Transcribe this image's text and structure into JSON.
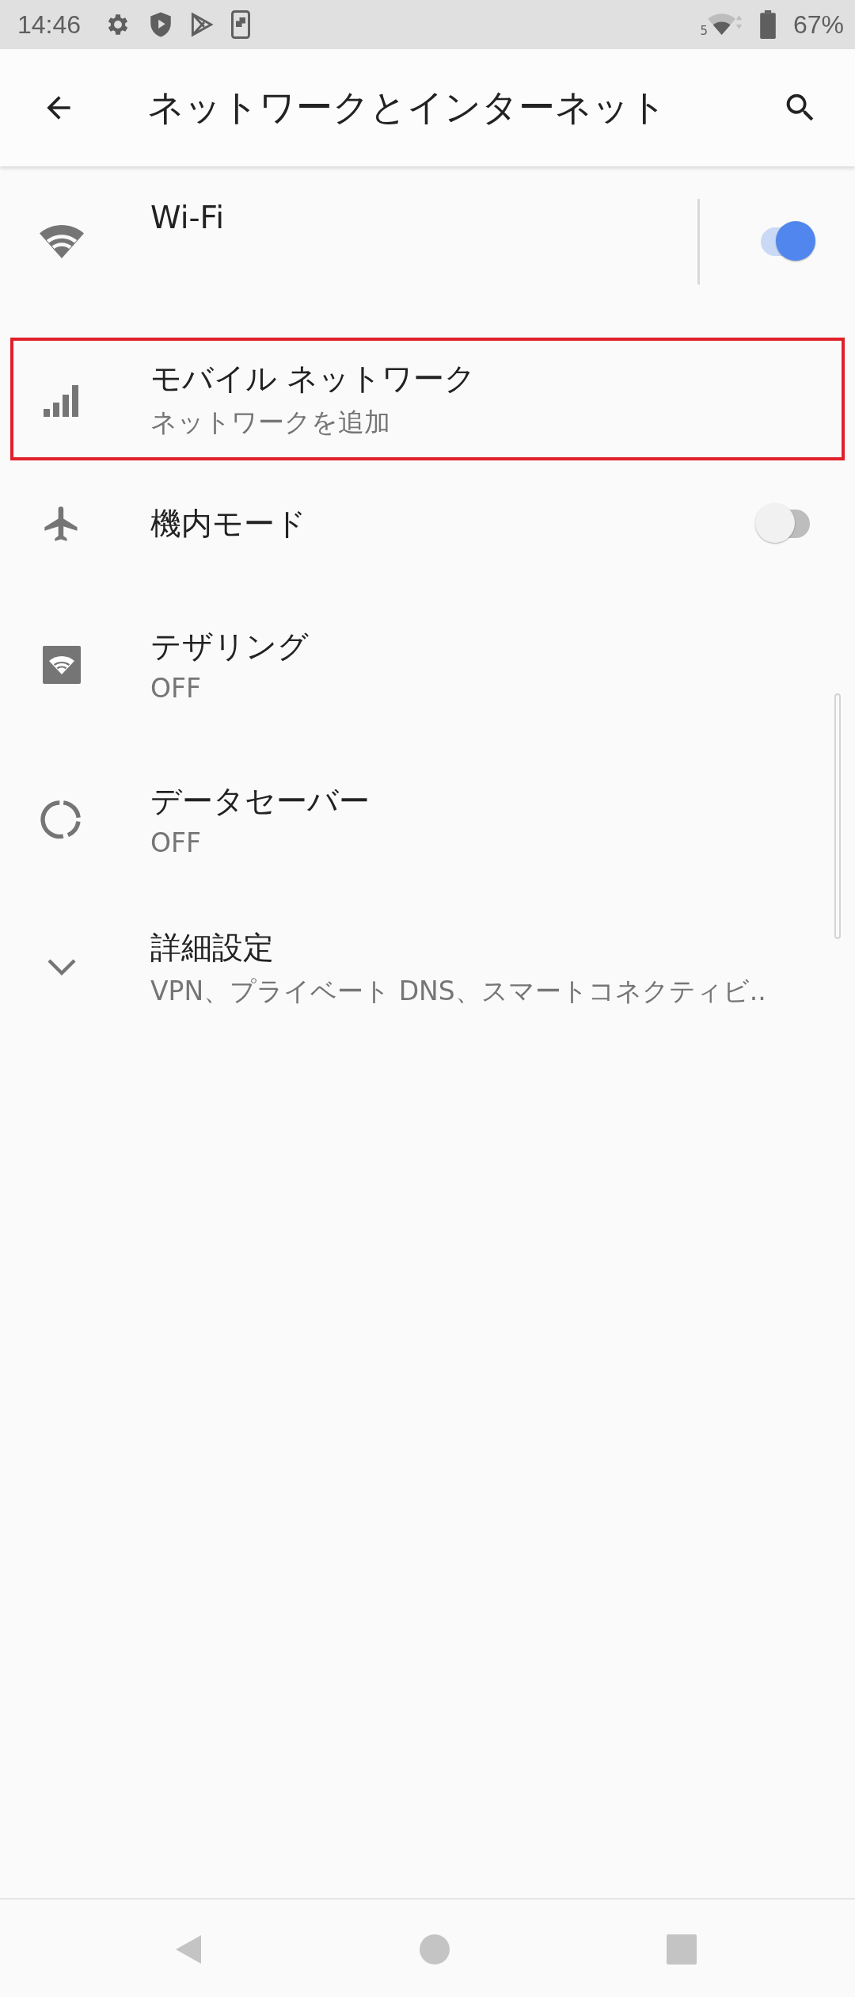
{
  "status_bar": {
    "time": "14:46",
    "wifi_label": "5",
    "battery": "67%"
  },
  "app_bar": {
    "title": "ネットワークとインターネット"
  },
  "items": [
    {
      "kind": "toggle",
      "title": "Wi-Fi",
      "on": true,
      "highlighted": false
    },
    {
      "kind": "plain",
      "title": "モバイル ネットワーク",
      "summary": "ネットワークを追加",
      "highlighted": true
    },
    {
      "kind": "toggle",
      "title": "機内モード",
      "on": false,
      "highlighted": false
    },
    {
      "kind": "plain",
      "title": "テザリング",
      "summary": "OFF",
      "highlighted": false
    },
    {
      "kind": "plain",
      "title": "データセーバー",
      "summary": "OFF",
      "highlighted": false
    },
    {
      "kind": "plain",
      "title": "詳細設定",
      "summary": "VPN、プライベート DNS、スマートコネクティビ..",
      "highlighted": false
    }
  ]
}
